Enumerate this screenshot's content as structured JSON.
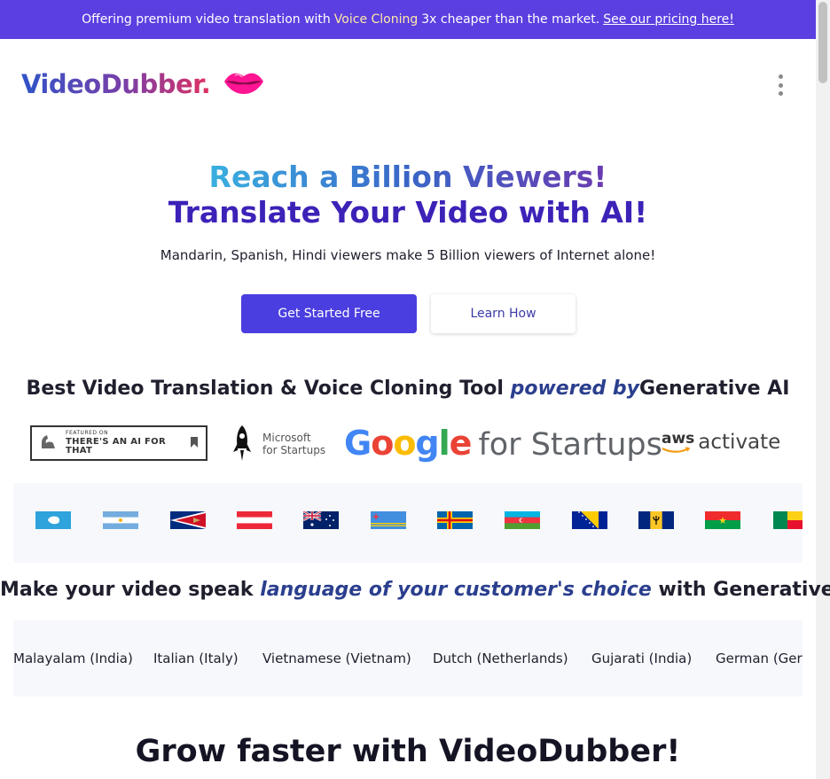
{
  "banner": {
    "text_before": "Offering premium video translation with",
    "highlight": "Voice Cloning",
    "text_after": "3x cheaper than the market.",
    "link": "See our pricing here!"
  },
  "header": {
    "logo_text": "VideoDubber.",
    "logo_icon": "lips-icon",
    "menu_icon": "kebab-menu-icon"
  },
  "hero": {
    "title_line1": "Reach a Billion Viewers!",
    "title_line2": "Translate Your Video with AI!",
    "subtitle": "Mandarin, Spanish, Hindi viewers make 5 Billion viewers of Internet alone!",
    "primary_button": "Get Started Free",
    "secondary_button": "Learn How"
  },
  "powered": {
    "before": "Best Video Translation & Voice Cloning Tool",
    "em": "powered by",
    "after": "Generative AI"
  },
  "partners": {
    "aiforthat_small": "FEATURED ON",
    "aiforthat_big": "THERE'S AN AI FOR THAT",
    "microsoft_line1": "Microsoft",
    "microsoft_line2": "for Startups",
    "google_letters": [
      "G",
      "o",
      "o",
      "g",
      "l",
      "e"
    ],
    "google_rest": "for Startups",
    "aws_word": "aws",
    "aws_activate": "activate"
  },
  "flags": [
    "antarctica",
    "argentina",
    "american-samoa",
    "austria",
    "australia",
    "aruba",
    "aland-islands",
    "azerbaijan",
    "bosnia-and-herzegovina",
    "barbados",
    "burkina-faso",
    "benin"
  ],
  "language_section": {
    "before": "Make your video speak",
    "em": "language of your customer's choice",
    "after": "with Generative AI"
  },
  "languages": [
    "Malayalam (India)",
    "Italian (Italy)",
    "Vietnamese (Vietnam)",
    "Dutch (Netherlands)",
    "Gujarati (India)",
    "German (Germany)"
  ],
  "grow": {
    "title": "Grow faster with VideoDubber!"
  },
  "colors": {
    "banner_bg": "#5b3fe0",
    "primary": "#4a3ee0",
    "title_dark": "#3d22b8",
    "lips": "#ff1493"
  }
}
